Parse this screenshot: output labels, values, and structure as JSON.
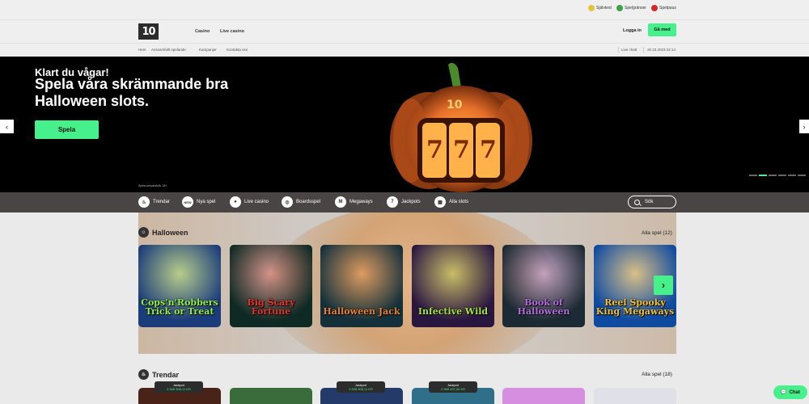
{
  "util": {
    "items": [
      "Självtest",
      "Spelgränser",
      "Spelpaus"
    ]
  },
  "header": {
    "logo": "10",
    "nav": [
      "Casino",
      "Live casino"
    ],
    "login": "Logga in",
    "join": "Gå med"
  },
  "subbar": {
    "links": [
      "Hem",
      "Ansvarsfullt spelande",
      "Kampanjer",
      "Kontakta oss"
    ],
    "live_chat": "Live chatt",
    "datetime": "20.10.2023 22:14"
  },
  "hero": {
    "title1": "Klart du vågar!",
    "title2": "Spela våra skrämmande bra Halloween slots.",
    "button": "Spela",
    "note": "Spela ansvarsfullt. 18+.",
    "pumpkin_logo": "10",
    "reels": [
      "7",
      "7",
      "7"
    ]
  },
  "categories": [
    {
      "label": "Trendar",
      "icon": "fire-icon"
    },
    {
      "label": "Nya spel",
      "icon": "new-icon"
    },
    {
      "label": "Live casino",
      "icon": "chip-icon"
    },
    {
      "label": "Boardsspel",
      "icon": "board-icon"
    },
    {
      "label": "Megaways",
      "icon": "megaways-icon"
    },
    {
      "label": "Jackpots",
      "icon": "seven-icon"
    },
    {
      "label": "Alla slots",
      "icon": "slots-icon"
    }
  ],
  "search": {
    "label": "Sök"
  },
  "sections": {
    "halloween": {
      "title": "Halloween",
      "all": "Alla spel (12)"
    },
    "trending": {
      "title": "Trendar",
      "all": "Alla spel (18)"
    }
  },
  "games": [
    {
      "title": "Cops'n'Robbers Trick or Treat",
      "bg": "#1b3c7a",
      "fg": "#8ef04a"
    },
    {
      "title": "Big Scary Fortune",
      "bg": "#0f2a25",
      "fg": "#e1362c"
    },
    {
      "title": "Halloween Jack",
      "bg": "#14303a",
      "fg": "#e8822c"
    },
    {
      "title": "Infective Wild",
      "bg": "#2a1740",
      "fg": "#a8e23a"
    },
    {
      "title": "Book of Halloween",
      "bg": "#1c2a33",
      "fg": "#b46ee0"
    },
    {
      "title": "Reel Spooky King Megaways",
      "bg": "#0d4aa0",
      "fg": "#f0c23a"
    }
  ],
  "jackpots": [
    {
      "label": "Jackpot",
      "amount": "3 528 305,11 KR"
    },
    {
      "label": "Jackpot",
      "amount": "3 528 305,11 KR"
    },
    {
      "label": "Jackpot",
      "amount": "2 968 437,06 KR"
    }
  ],
  "trend_tiles": [
    "#4a2318",
    "#3a6b3a",
    "#243b6a",
    "#2f6f8a",
    "#d58ee0",
    "#e0e0e8"
  ],
  "chat": "Chat",
  "colors": {
    "accent": "#46f08a",
    "category_bar": "#4a4545",
    "pumpkin": "#e8702a"
  }
}
